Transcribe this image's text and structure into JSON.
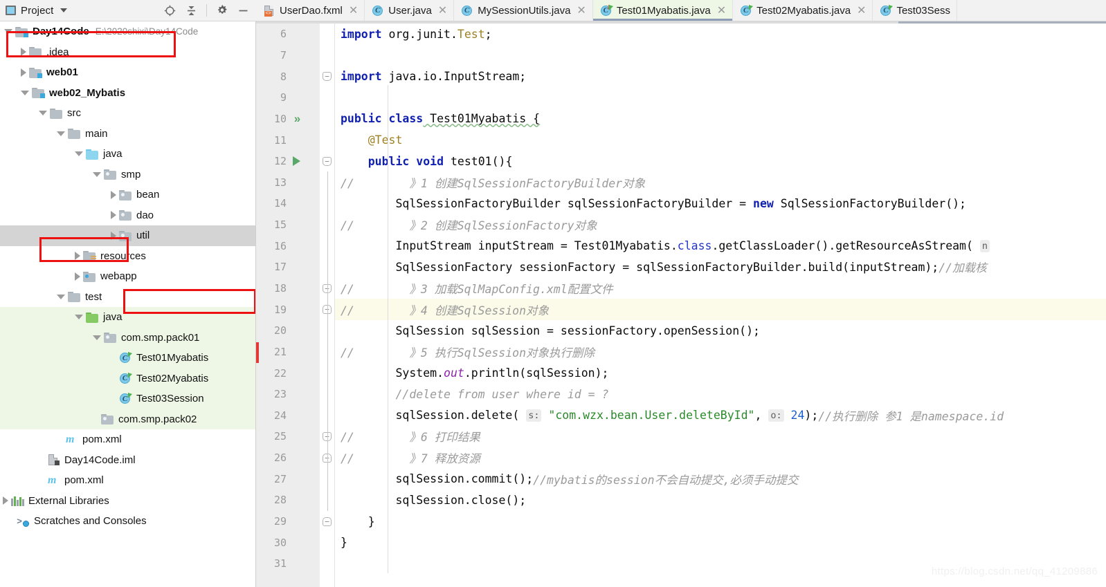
{
  "project_panel": {
    "title": "Project",
    "icons": [
      "project-icon",
      "chevron-down-icon",
      "locate-icon",
      "collapse-all-icon",
      "settings-gear-icon",
      "minimize-icon"
    ],
    "tree": [
      {
        "indent": 0,
        "arrow": "open",
        "icon": "module-folder",
        "label": "Day14Code",
        "bold": true,
        "path": "E:\\2020shixi\\Day14Code",
        "bg": "none"
      },
      {
        "indent": 1,
        "arrow": "closed",
        "icon": "folder-gray",
        "label": ".idea",
        "bold": false,
        "path": "",
        "bg": "none"
      },
      {
        "indent": 1,
        "arrow": "closed",
        "icon": "module-folder",
        "label": "web01",
        "bold": true,
        "path": "",
        "bg": "none"
      },
      {
        "indent": 1,
        "arrow": "open",
        "icon": "module-folder",
        "label": "web02_Mybatis",
        "bold": true,
        "path": "",
        "bg": "none"
      },
      {
        "indent": 2,
        "arrow": "open",
        "icon": "folder-gray",
        "label": "src",
        "bold": false,
        "path": "",
        "bg": "none"
      },
      {
        "indent": 3,
        "arrow": "open",
        "icon": "folder-gray",
        "label": "main",
        "bold": false,
        "path": "",
        "bg": "none"
      },
      {
        "indent": 4,
        "arrow": "open",
        "icon": "folder-blue",
        "label": "java",
        "bold": false,
        "path": "",
        "bg": "none"
      },
      {
        "indent": 5,
        "arrow": "open",
        "icon": "package",
        "label": "smp",
        "bold": false,
        "path": "",
        "bg": "none"
      },
      {
        "indent": 6,
        "arrow": "closed",
        "icon": "package",
        "label": "bean",
        "bold": false,
        "path": "",
        "bg": "none"
      },
      {
        "indent": 6,
        "arrow": "closed",
        "icon": "package",
        "label": "dao",
        "bold": false,
        "path": "",
        "bg": "none"
      },
      {
        "indent": 6,
        "arrow": "closed",
        "icon": "package",
        "label": "util",
        "bold": false,
        "path": "",
        "bg": "gray"
      },
      {
        "indent": 4,
        "arrow": "closed",
        "icon": "resources-folder",
        "label": "resources",
        "bold": false,
        "path": "",
        "bg": "none"
      },
      {
        "indent": 4,
        "arrow": "closed",
        "icon": "webapp-folder",
        "label": "webapp",
        "bold": false,
        "path": "",
        "bg": "none"
      },
      {
        "indent": 3,
        "arrow": "open",
        "icon": "folder-gray",
        "label": "test",
        "bold": false,
        "path": "",
        "bg": "none"
      },
      {
        "indent": 4,
        "arrow": "open",
        "icon": "folder-green",
        "label": "java",
        "bold": false,
        "path": "",
        "bg": "green"
      },
      {
        "indent": 5,
        "arrow": "open",
        "icon": "package",
        "label": "com.smp.pack01",
        "bold": false,
        "path": "",
        "bg": "green"
      },
      {
        "indent": 6,
        "arrow": "none",
        "icon": "java-class",
        "label": "Test01Myabatis",
        "bold": false,
        "path": "",
        "bg": "green"
      },
      {
        "indent": 6,
        "arrow": "none",
        "icon": "java-class",
        "label": "Test02Myabatis",
        "bold": false,
        "path": "",
        "bg": "green"
      },
      {
        "indent": 6,
        "arrow": "none",
        "icon": "java-class",
        "label": "Test03Session",
        "bold": false,
        "path": "",
        "bg": "green"
      },
      {
        "indent": 5,
        "arrow": "none",
        "icon": "package",
        "label": "com.smp.pack02",
        "bold": false,
        "path": "",
        "bg": "green"
      },
      {
        "indent": 4,
        "arrow": "none",
        "icon": "maven-pom",
        "label": "pom.xml",
        "bold": false,
        "path": "",
        "bg": "none"
      },
      {
        "indent": 3,
        "arrow": "none",
        "icon": "iml-file",
        "label": "Day14Code.iml",
        "bold": false,
        "path": "",
        "bg": "none"
      },
      {
        "indent": 3,
        "arrow": "none",
        "icon": "maven-pom",
        "label": "pom.xml",
        "bold": false,
        "path": "",
        "bg": "none"
      },
      {
        "indent": 1,
        "arrow": "closed",
        "icon": "external-libraries",
        "label": "External Libraries",
        "bold": false,
        "path": "",
        "bg": "none"
      },
      {
        "indent": 1,
        "arrow": "none",
        "icon": "scratches",
        "label": "Scratches and Consoles",
        "bold": false,
        "path": "",
        "bg": "none"
      }
    ]
  },
  "tabs": [
    {
      "label": "UserDao.fxml",
      "icon": "fxml-file-icon",
      "selected": false
    },
    {
      "label": "User.java",
      "icon": "java-class-icon",
      "selected": false
    },
    {
      "label": "MySessionUtils.java",
      "icon": "java-class-icon",
      "selected": false
    },
    {
      "label": "Test01Myabatis.java",
      "icon": "java-test-class-icon",
      "selected": true
    },
    {
      "label": "Test02Myabatis.java",
      "icon": "java-test-class-icon",
      "selected": false
    },
    {
      "label": "Test03Sess",
      "icon": "java-test-class-icon",
      "selected": false
    }
  ],
  "editor": {
    "first_line": 6,
    "lines": [
      {
        "n": 6,
        "run": "",
        "fold": "",
        "hl": false
      },
      {
        "n": 7,
        "run": "",
        "fold": "",
        "hl": false
      },
      {
        "n": 8,
        "run": "",
        "fold": "minus",
        "hl": false
      },
      {
        "n": 9,
        "run": "",
        "fold": "",
        "hl": false
      },
      {
        "n": 10,
        "run": "chev",
        "fold": "",
        "hl": false
      },
      {
        "n": 11,
        "run": "",
        "fold": "",
        "hl": false
      },
      {
        "n": 12,
        "run": "tri",
        "fold": "minus",
        "hl": false
      },
      {
        "n": 13,
        "run": "",
        "fold": "",
        "hl": false
      },
      {
        "n": 14,
        "run": "",
        "fold": "",
        "hl": false
      },
      {
        "n": 15,
        "run": "",
        "fold": "",
        "hl": false
      },
      {
        "n": 16,
        "run": "",
        "fold": "",
        "hl": false
      },
      {
        "n": 17,
        "run": "",
        "fold": "",
        "hl": false
      },
      {
        "n": 18,
        "run": "",
        "fold": "minus",
        "hl": false
      },
      {
        "n": 19,
        "run": "",
        "fold": "up",
        "hl": true
      },
      {
        "n": 20,
        "run": "",
        "fold": "",
        "hl": false
      },
      {
        "n": 21,
        "run": "",
        "fold": "",
        "hl": false
      },
      {
        "n": 22,
        "run": "",
        "fold": "",
        "hl": false
      },
      {
        "n": 23,
        "run": "",
        "fold": "",
        "hl": false
      },
      {
        "n": 24,
        "run": "",
        "fold": "",
        "hl": false
      },
      {
        "n": 25,
        "run": "",
        "fold": "minus",
        "hl": false
      },
      {
        "n": 26,
        "run": "",
        "fold": "up",
        "hl": false
      },
      {
        "n": 27,
        "run": "",
        "fold": "",
        "hl": false
      },
      {
        "n": 28,
        "run": "",
        "fold": "",
        "hl": false
      },
      {
        "n": 29,
        "run": "",
        "fold": "up",
        "hl": false
      },
      {
        "n": 30,
        "run": "",
        "fold": "",
        "hl": false
      },
      {
        "n": 31,
        "run": "",
        "fold": "",
        "hl": false
      }
    ],
    "code_text": {
      "l6": "import org.junit.Test;",
      "l8": "import java.io.InputStream;",
      "l10": "public class Test01Myabatis {",
      "l11": "    @Test",
      "l12": "    public void test01(){",
      "l13": "//        》1 创建SqlSessionFactoryBuilder对象",
      "l14": "        SqlSessionFactoryBuilder sqlSessionFactoryBuilder = new SqlSessionFactoryBuilder();",
      "l15": "//        》2 创建SqlSessionFactory对象",
      "l16": "        InputStream inputStream = Test01Myabatis.class.getClassLoader().getResourceAsStream( n",
      "l17": "        SqlSessionFactory sessionFactory = sqlSessionFactoryBuilder.build(inputStream);//加载核",
      "l18": "//        》3 加载SqlMapConfig.xml配置文件",
      "l19": "//        》4 创建SqlSession对象",
      "l20": "        SqlSession sqlSession = sessionFactory.openSession();",
      "l21": "//        》5 执行SqlSession对象执行删除",
      "l22": "        System.out.println(sqlSession);",
      "l23": "        //delete from user where id = ?",
      "l24": "        sqlSession.delete( s: \"com.wzx.bean.User.deleteById\", o: 24);//执行删除 参1 是namespace.id",
      "l25": "//        》6 打印结果",
      "l26": "//        》7 释放资源",
      "l27": "        sqlSession.commit();//mybatis的session不会自动提交,必须手动提交",
      "l28": "        sqlSession.close();",
      "l29": "    }",
      "l30": "}"
    },
    "tokens": {
      "kw_import": "import",
      "kw_public": "public",
      "kw_class": "class",
      "kw_void": "void",
      "kw_new": "new",
      "kw_classref": "class",
      "id_orgjunit": " org.junit.",
      "id_Test": "Test",
      "semi": ";",
      "id_javaio": " java.io.InputStream;",
      "id_clsname": " Test01Myabatis {",
      "ann_test": "@Test",
      "mth_test01": " test01(){",
      "cmt13": "//        》1 创建SqlSessionFactoryBuilder对象",
      "l14a": "        SqlSessionFactoryBuilder sqlSessionFactoryBuilder = ",
      "l14b": "new",
      "l14c": " SqlSessionFactoryBuilder();",
      "cmt15": "//        》2 创建SqlSessionFactory对象",
      "l16a": "        InputStream inputStream = Test01Myabatis.",
      "l16b": "class",
      "l16c": ".getClassLoader().getResourceAsStream( ",
      "l16d": "n",
      "l17a": "        SqlSessionFactory sessionFactory = sqlSessionFactoryBuilder.build(inputStream);",
      "l17b": "//加载核",
      "cmt18": "//        》3 加载SqlMapConfig.xml配置文件",
      "cmt19": "//        》4 创建SqlSession对象",
      "l20a": "        SqlSession sqlSession = sessionFactory.openSession();",
      "cmt21": "//        》5 执行SqlSession对象执行删除",
      "l22a": "        System.",
      "l22b": "out",
      "l22c": ".println(sqlSession);",
      "cmt23": "        //delete from user where id = ?",
      "l24a": "        sqlSession.delete( ",
      "l24hint1": "s:",
      "l24b": " \"com.wzx.bean.User.deleteById\"",
      "l24c": ", ",
      "l24hint2": "o:",
      "l24d": " 24",
      "l24e": ");",
      "l24f": "//执行删除 参1 是namespace.id",
      "cmt25": "//        》6 打印结果",
      "cmt26": "//        》7 释放资源",
      "l27a": "        sqlSession.commit();",
      "l27b": "//mybatis的session不会自动提交,必须手动提交",
      "l28a": "        sqlSession.close();",
      "l29a": "    }",
      "l30a": "}"
    }
  },
  "watermark": "https://blog.csdn.net/qq_41209886",
  "colors": {
    "keyword": "#0f1fb0",
    "annotation": "#9e8022",
    "string": "#2a8a2a",
    "number": "#1a5fd0",
    "comment": "#9a9a9a",
    "static_field": "#8c24a8",
    "test_source_bg": "#eef7e6",
    "selected_row_bg": "#d4d4d4",
    "caret_line_bg": "#fcfae8",
    "annotation_box": "#ee1111",
    "run_green": "#59a869"
  }
}
